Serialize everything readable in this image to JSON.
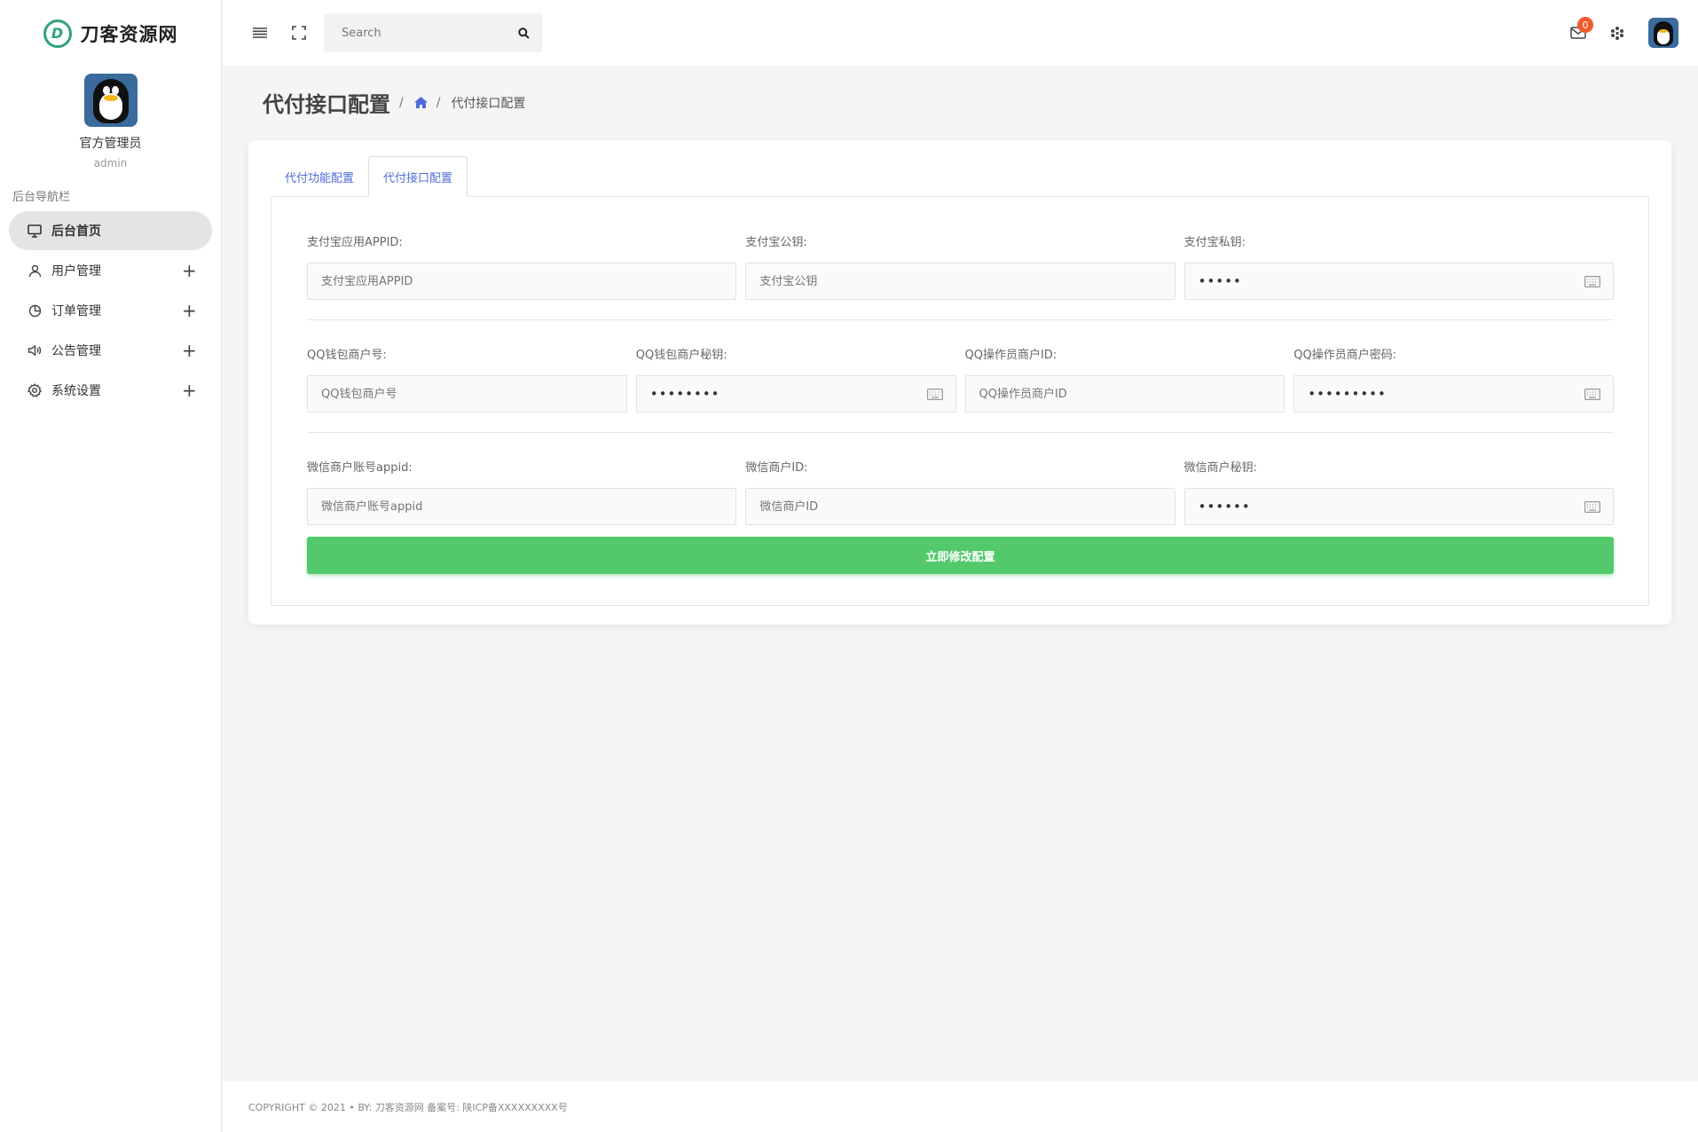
{
  "brand": {
    "name": "刀客资源网",
    "logo_letter": "D"
  },
  "profile": {
    "name": "官方管理员",
    "role": "admin"
  },
  "sidebar": {
    "heading": "后台导航栏",
    "items": [
      {
        "label": "后台首页",
        "icon": "monitor-icon",
        "active": true
      },
      {
        "label": "用户管理",
        "icon": "user-icon"
      },
      {
        "label": "订单管理",
        "icon": "pie-chart-icon"
      },
      {
        "label": "公告管理",
        "icon": "speaker-icon"
      },
      {
        "label": "系统设置",
        "icon": "gear-icon"
      }
    ],
    "expand_symbol": "+"
  },
  "topbar": {
    "search_placeholder": "Search",
    "mail_badge": "0"
  },
  "page": {
    "title": "代付接口配置",
    "breadcrumb_sep": "/",
    "breadcrumb_current": "代付接口配置"
  },
  "tabs": [
    {
      "label": "代付功能配置",
      "active": false
    },
    {
      "label": "代付接口配置",
      "active": true
    }
  ],
  "form": {
    "alipay_appid": {
      "label": "支付宝应用APPID:",
      "placeholder": "支付宝应用APPID"
    },
    "alipay_pubkey": {
      "label": "支付宝公钥:",
      "placeholder": "支付宝公钥"
    },
    "alipay_privkey": {
      "label": "支付宝私钥:",
      "value": "•••••"
    },
    "qq_merchant": {
      "label": "QQ钱包商户号:",
      "placeholder": "QQ钱包商户号"
    },
    "qq_merchant_key": {
      "label": "QQ钱包商户秘钥:",
      "value": "••••••••"
    },
    "qq_operator_id": {
      "label": "QQ操作员商户ID:",
      "placeholder": "QQ操作员商户ID"
    },
    "qq_operator_pwd": {
      "label": "QQ操作员商户密码:",
      "value": "•••••••••"
    },
    "wx_appid": {
      "label": "微信商户账号appid:",
      "placeholder": "微信商户账号appid"
    },
    "wx_mchid": {
      "label": "微信商户ID:",
      "placeholder": "微信商户ID"
    },
    "wx_key": {
      "label": "微信商户秘钥:",
      "value": "••••••"
    },
    "submit_label": "立即修改配置"
  },
  "footer": {
    "text": "COPYRIGHT © 2021 • BY: 刀客资源网   备案号: 陕ICP备XXXXXXXXX号"
  },
  "colors": {
    "accent": "#4f6dd8",
    "submit": "#52c96a",
    "badge": "#f05a2a",
    "brand": "#2fa37a"
  }
}
